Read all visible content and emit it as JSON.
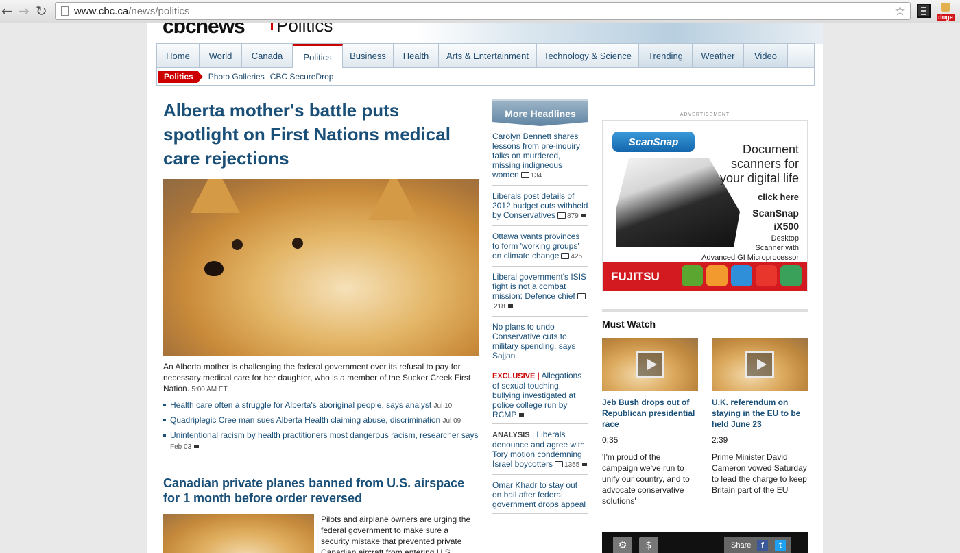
{
  "browser": {
    "url_domain": "www.cbc.ca",
    "url_path": "/news/politics",
    "ext_label": "doge"
  },
  "masthead": {
    "logo": "cbcnews",
    "section": "Politics"
  },
  "nav": {
    "tabs": [
      "Home",
      "World",
      "Canada",
      "Politics",
      "Business",
      "Health",
      "Arts & Entertainment",
      "Technology & Science",
      "Trending",
      "Weather",
      "Video"
    ],
    "active_tab": "Politics",
    "sub_pill": "Politics",
    "sub_links": [
      "Photo Galleries",
      "CBC SecureDrop"
    ]
  },
  "main": {
    "headline": "Alberta mother's battle puts spotlight on First Nations medical care rejections",
    "summary": "An Alberta mother is challenging the federal government over its refusal to pay for necessary medical care for her daughter, who is a member of the Sucker Creek First Nation.",
    "summary_time": "5:00 AM ET",
    "related": [
      {
        "text": "Health care often a struggle for Alberta's aboriginal people, says analyst",
        "date": "Jul 10"
      },
      {
        "text": "Quadriplegic Cree man sues Alberta Health claiming abuse, discrimination",
        "date": "Jul 09"
      },
      {
        "text": "Unintentional racism by health practitioners most dangerous racism, researcher says",
        "date": "Feb 03"
      }
    ],
    "headline2": "Canadian private planes banned from U.S. airspace for 1 month before order reversed",
    "summary2": "Pilots and airplane owners are urging the federal government to make sure a security mistake that prevented private Canadian aircraft from entering U.S."
  },
  "headlines": {
    "title": "More Headlines",
    "items": [
      {
        "tag": "",
        "text": "Carolyn Bennett shares lessons from pre-inquiry talks on murdered, missing indigneous women",
        "count": "134"
      },
      {
        "tag": "",
        "text": "Liberals post details of 2012 budget cuts withheld by Conservatives",
        "count": "879"
      },
      {
        "tag": "",
        "text": "Ottawa wants provinces to form 'working groups' on climate change",
        "count": "425"
      },
      {
        "tag": "",
        "text": "Liberal government's ISIS fight is not a combat mission: Defence chief",
        "count": "218"
      },
      {
        "tag": "",
        "text": "No plans to undo Conservative cuts to military spending, says Sajjan",
        "count": ""
      },
      {
        "tag": "EXCLUSIVE",
        "text": "Allegations of sexual touching, bullying investigated at police college run by RCMP",
        "count": ""
      },
      {
        "tag": "ANALYSIS",
        "text": "Liberals denounce and agree with Tory motion condemning Israel boycotters",
        "count": "1355"
      },
      {
        "tag": "",
        "text": "Omar Khadr to stay out on bail after federal government drops appeal",
        "count": ""
      }
    ]
  },
  "ad": {
    "label": "ADVERTISEMENT",
    "logo": "ScanSnap",
    "tagline": [
      "Document",
      "scanners for",
      "your digital life"
    ],
    "click": "click here",
    "model": [
      "ScanSnap",
      "iX500"
    ],
    "desc": [
      "Desktop",
      "Scanner with",
      "Advanced GI Microprocessor"
    ],
    "brand": "FUJITSU",
    "app_colors": [
      "#5aa631",
      "#f29a2e",
      "#2f8fd8",
      "#e8362d",
      "#3aa15a"
    ]
  },
  "must_watch": {
    "title": "Must Watch",
    "items": [
      {
        "headline": "Jeb Bush drops out of Republican presidential race",
        "duration": "0:35",
        "desc": "'I'm proud of the campaign we've run to unify our country, and to advocate conservative solutions'"
      },
      {
        "headline": "U.K. referendum on staying in the EU to be held June 23",
        "duration": "2:39",
        "desc": "Prime Minister David Cameron vowed Saturday to lead the charge to keep Britain part of the EU"
      }
    ]
  },
  "player": {
    "share": "Share",
    "fb": "f",
    "tw": "t"
  }
}
